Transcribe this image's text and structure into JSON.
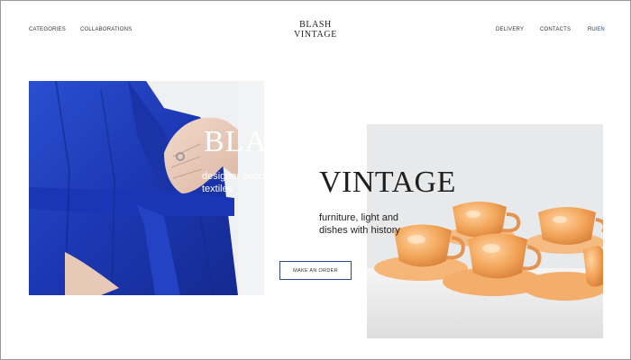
{
  "nav": {
    "left": [
      "CATEGORIES",
      "COLLABORATIONS"
    ],
    "right": [
      "DELIVERY",
      "CONTACTS"
    ],
    "lang_ru": "RU",
    "lang_sep": "/",
    "lang_en": "EN"
  },
  "logo": {
    "line1": "BLASH",
    "line2": "VINTAGE"
  },
  "hero": {
    "brand_left": "BLASH",
    "tagline_left": "designer decor and textiles",
    "brand_right": "VINTAGE",
    "tagline_right": "furniture, light and dishes with history",
    "cta": "MAKE AN ORDER"
  },
  "colors": {
    "accent": "#1e4fbd",
    "robe_blue": "#1f3fc0",
    "cup_orange": "#f0a050"
  },
  "images": {
    "left": "blue-linen-robe-photo",
    "right": "orange-glass-cups-photo"
  }
}
